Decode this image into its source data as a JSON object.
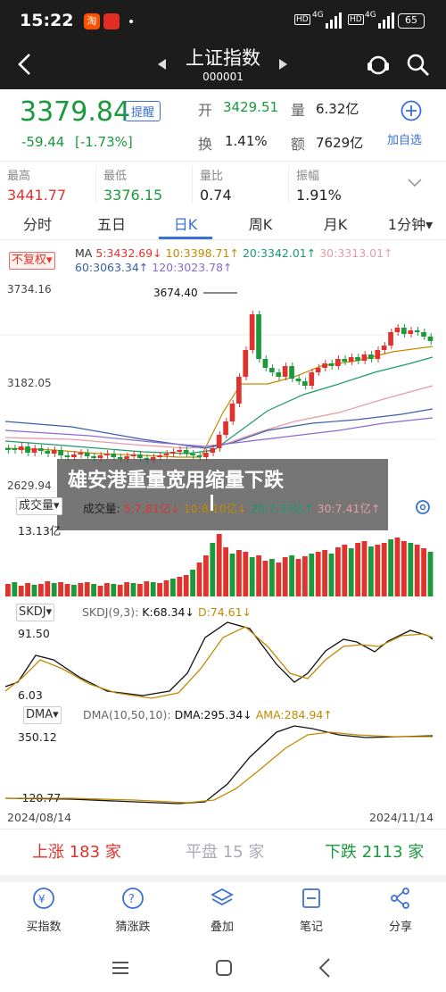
{
  "status": {
    "time": "15:22",
    "battery": "65",
    "net1": "HD",
    "net2": "HD",
    "sig1": "4G",
    "sig2": "4G"
  },
  "nav": {
    "title": "上证指数",
    "code": "000001"
  },
  "quote": {
    "price": "3379.84",
    "remind": "提醒",
    "change": "-59.44",
    "pct": "[-1.73%]",
    "open_label": "开",
    "open": "3429.51",
    "vol_label": "量",
    "vol": "6.32亿",
    "turn_label": "换",
    "turn": "1.41%",
    "amt_label": "额",
    "amt": "7629亿",
    "add_watch": "加自选"
  },
  "stats": [
    {
      "label": "最高",
      "value": "3441.77",
      "color": "#e0332e"
    },
    {
      "label": "最低",
      "value": "3376.15",
      "color": "#1a9a3a"
    },
    {
      "label": "量比",
      "value": "0.74",
      "color": "#222"
    },
    {
      "label": "振幅",
      "value": "1.91%",
      "color": "#222"
    }
  ],
  "tabs": [
    "分时",
    "五日",
    "日K",
    "周K",
    "月K",
    "1分钟▾"
  ],
  "active_tab": 2,
  "ma": {
    "fq": "不复权▾",
    "label": "MA",
    "ma5": "5:3432.69↓",
    "ma10": "10:3398.71↑",
    "ma20": "20:3342.01↑",
    "ma30": "30:3313.01↑",
    "ma60": "60:3063.34↑",
    "ma120": "120:3023.78↑"
  },
  "kline": {
    "ymax": "3734.16",
    "ymid": "3182.05",
    "ymin": "2629.94",
    "peak": "3674.40"
  },
  "overlay": {
    "text": "雄安港重量宽用缩量下跌"
  },
  "vol": {
    "sel": "成交量▾",
    "label": "成交量:",
    "v5": "5:7.81亿↓",
    "v10": "10:8.10亿↓",
    "v20": "20:7.33亿↑",
    "v30": "30:7.41亿↑",
    "ymax": "13.13亿"
  },
  "skdj": {
    "sel": "SKDJ▾",
    "name": "SKDJ(9,3):",
    "k": "K:68.34↓",
    "d": "D:74.61↓",
    "ymax": "91.50",
    "ymin": "6.03"
  },
  "dma": {
    "sel": "DMA▾",
    "name": "DMA(10,50,10):",
    "dma": "DMA:295.34↓",
    "ama": "AMA:284.94↑",
    "ymax": "350.12",
    "ymin": "-120.77"
  },
  "dates": {
    "start": "2024/08/14",
    "end": "2024/11/14"
  },
  "breadth": {
    "up_label": "上涨",
    "up": "183",
    "unit": "家",
    "flat_label": "平盘",
    "flat": "15",
    "down_label": "下跌",
    "down": "2113"
  },
  "bottom": [
    "买指数",
    "猜涨跌",
    "叠加",
    "笔记",
    "分享"
  ]
}
